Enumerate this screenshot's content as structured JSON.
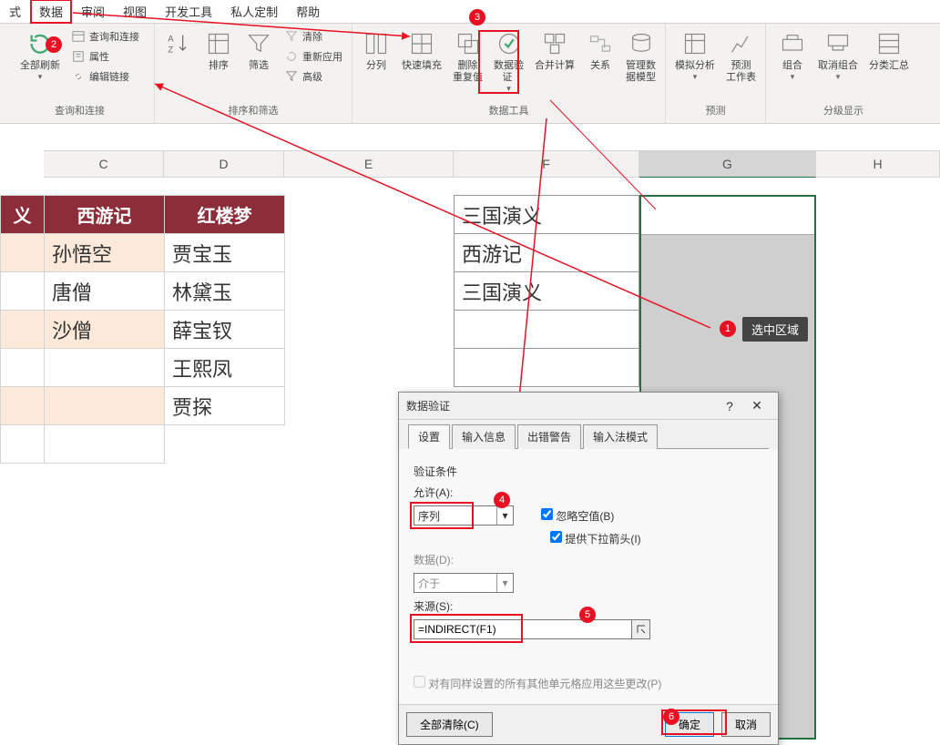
{
  "tabs": {
    "t0": "式",
    "t1": "数据",
    "t2": "审阅",
    "t3": "视图",
    "t4": "开发工具",
    "t5": "私人定制",
    "t6": "帮助"
  },
  "ribbon": {
    "refresh_all": "全部刷新",
    "queries": "查询和连接",
    "props": "属性",
    "editlinks": "编辑链接",
    "group_queries": "查询和连接",
    "sort": "排序",
    "filter": "筛选",
    "clear": "清除",
    "reapply": "重新应用",
    "advanced": "高级",
    "group_sort": "排序和筛选",
    "texttocol": "分列",
    "flashfill": "快速填充",
    "removedup": "删除\n重复值",
    "datavalid": "数据验\n证 ",
    "consolidate": "合并计算",
    "relations": "关系",
    "managemodel": "管理数\n据模型",
    "group_datatools": "数据工具",
    "whatif": "模拟分析",
    "forecast": "预测\n工作表",
    "group_forecast": "预测",
    "groupbtn": "组合",
    "ungroup": "取消组合",
    "subtotal": "分类汇总",
    "group_outline": "分级显示"
  },
  "columns": {
    "c": "C",
    "d": "D",
    "e": "E",
    "f": "F",
    "g": "G",
    "h": "H"
  },
  "table": {
    "h1": "义",
    "h2": "西游记",
    "h3": "红楼梦",
    "r1c": "孙悟空",
    "r1d": "贾宝玉",
    "r2c": "唐僧",
    "r2d": "林黛玉",
    "r3c": "沙僧",
    "r3d": "薛宝钗",
    "r4d": "王熙凤",
    "r5d": "贾探"
  },
  "fcol": {
    "f1": "三国演义",
    "f2": "西游记",
    "f3": "三国演义"
  },
  "anno": {
    "tip1": "选中区域"
  },
  "dialog": {
    "title": "数据验证",
    "tab_settings": "设置",
    "tab_input": "输入信息",
    "tab_error": "出错警告",
    "tab_ime": "输入法模式",
    "cond_label": "验证条件",
    "allow_label": "允许(A):",
    "allow_value": "序列",
    "ignore_blank": "忽略空值(B)",
    "dropdown": "提供下拉箭头(I)",
    "data_label": "数据(D):",
    "data_value": "介于",
    "source_label": "来源(S):",
    "source_value": "=INDIRECT(F1)",
    "apply_others": "对有同样设置的所有其他单元格应用这些更改(P)",
    "clear_all": "全部清除(C)",
    "ok": "确定",
    "cancel": "取消"
  }
}
